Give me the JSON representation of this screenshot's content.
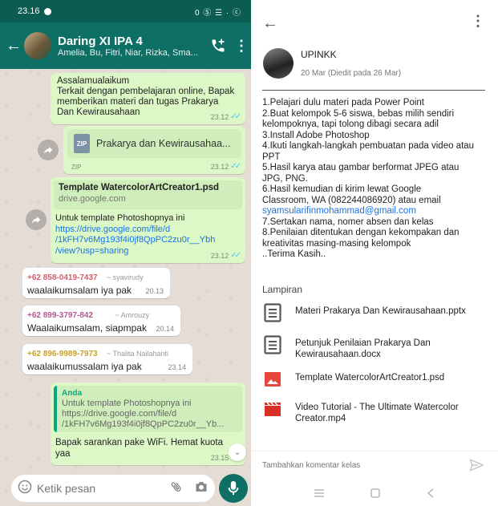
{
  "whatsapp": {
    "status_bar": {
      "time": "23.16",
      "right": "0 Ⓢ ☰ · ⓒ"
    },
    "header": {
      "title": "Daring XI IPA 4",
      "subtitle": "Amelia, Bu, Fitri, Niar, Rizka, Sma..."
    },
    "messages": {
      "m1": {
        "text_1": "Assalamualaikum",
        "text_2": "Terkait dengan pembelajaran online, Bapak",
        "text_3": "memberikan materi dan tugas Prakarya",
        "text_4": "Dan Kewirausahaan",
        "time": "23.12"
      },
      "m2": {
        "file_badge": "ZIP",
        "file_name": "Prakarya dan Kewirausahaa...",
        "file_type": "ZIP",
        "time": "23.12"
      },
      "m3": {
        "link_title": "Template WatercolorArtCreator1.psd",
        "link_domain": "drive.google.com",
        "text_1": "Untuk template Photoshopnya ini",
        "url_1": "https://drive.google.com/file/d",
        "url_2": "/1kFH7v6Mg193f4i0jf8QpPC2zu0r__Ybh",
        "url_3": "/view?usp=sharing",
        "time": "23.12"
      },
      "m4": {
        "phone": "+62 858-0419-7437",
        "name": "~ syavirudy",
        "text": "waalaikumsalam iya pak",
        "time": "20.13"
      },
      "m5": {
        "phone": "+62 899-3797-842",
        "name": "~ Amrouzy",
        "text": "Waalaikumsalam, siapmpak",
        "time": "20.14"
      },
      "m6": {
        "phone": "+62 896-9989-7973",
        "name": "~ Thalita Nailahanti",
        "text": "waalaikumussalam iya pak",
        "time": "23.14"
      },
      "m7": {
        "quote_author": "Anda",
        "quote_1": "Untuk template Photoshopnya ini",
        "quote_2": "https://drive.google.com/file/d",
        "quote_3": "/1kFH7v6Mg193f4i0jf8QpPC2zu0r__Yb...",
        "text_1": "Bapak sarankan pake WiFi. Hemat kuota",
        "text_2": "yaa",
        "time": "23.15"
      }
    },
    "input": {
      "placeholder": "Ketik pesan"
    }
  },
  "classroom": {
    "author": "UPINKK",
    "date": "20 Mar (Diedit pada 26 Mar)",
    "body": {
      "l1": "1.Pelajari dulu materi pada Power Point",
      "l2": "2.Buat kelompok 5-6 siswa, bebas milih sendiri",
      "l3": "kelompoknya, tapi tolong dibagi secara adil",
      "l4": "3.Install Adobe Photoshop",
      "l5": "4.Ikuti langkah-langkah pembuatan pada video atau",
      "l6": "PPT",
      "l7": "5.Hasil karya atau gambar berformat JPEG atau",
      "l8": "JPG, PNG.",
      "l9": "6.Hasil kemudian di kirim lewat Google",
      "l10": "Classroom, WA (082244086920) atau email",
      "email": "syamsularifinmohammad@gmail.com",
      "l11": "7.Sertakan nama, nomer absen dan kelas",
      "l12": "8.Penilaian ditentukan dengan kekompakan dan",
      "l13": "kreativitas masing-masing kelompok",
      "l14": "..Terima Kasih.."
    },
    "attachments_label": "Lampiran",
    "attachments": {
      "a1": {
        "name_1": "Materi Prakarya Dan Kewirausahaan.pptx",
        "icon": "document-icon"
      },
      "a2": {
        "name_1": "Petunjuk Penilaian Prakarya Dan",
        "name_2": "Kewirausahaan.docx",
        "icon": "document-icon"
      },
      "a3": {
        "name_1": "Template WatercolorArtCreator1.psd",
        "icon": "image-icon"
      },
      "a4": {
        "name_1": "Video Tutorial - The Ultimate Watercolor",
        "name_2": "Creator.mp4",
        "icon": "video-icon"
      }
    },
    "comment_placeholder": "Tambahkan komentar kelas"
  },
  "colors": {
    "wa_header": "#0e7065",
    "wa_bubble_out": "#dcf8c6",
    "wa_bg": "#e5ddd5",
    "link": "#1a73e8",
    "image_icon_red": "#e8453c"
  }
}
